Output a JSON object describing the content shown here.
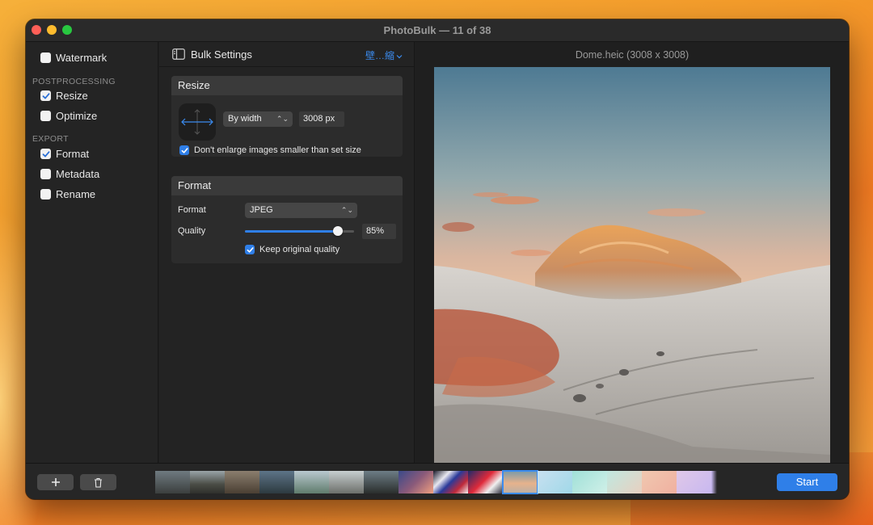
{
  "window": {
    "title": "PhotoBulk — 11 of 38"
  },
  "sidebar": {
    "items": [
      {
        "label": "Watermark",
        "checked": false
      }
    ],
    "sections": [
      {
        "title": "POSTPROCESSING",
        "items": [
          {
            "label": "Resize",
            "checked": true
          },
          {
            "label": "Optimize",
            "checked": false
          }
        ]
      },
      {
        "title": "EXPORT",
        "items": [
          {
            "label": "Format",
            "checked": true
          },
          {
            "label": "Metadata",
            "checked": false
          },
          {
            "label": "Rename",
            "checked": false
          }
        ]
      }
    ]
  },
  "settings": {
    "title": "Bulk Settings",
    "menu_label": "壁…縮",
    "resize": {
      "header": "Resize",
      "mode": "By width",
      "value": "3008 px",
      "no_enlarge_label": "Don't enlarge images smaller than set size",
      "no_enlarge_checked": true
    },
    "format": {
      "header": "Format",
      "format_label": "Format",
      "format_value": "JPEG",
      "quality_label": "Quality",
      "quality_value": "85%",
      "quality_fraction": 0.85,
      "keep_label": "Keep original quality",
      "keep_checked": true
    }
  },
  "preview": {
    "filename": "Dome.heic (3008 x 3008)"
  },
  "bottombar": {
    "start_label": "Start",
    "selected_thumbnail_index": 10
  },
  "colors": {
    "accent": "#2f7fe8",
    "window_bg": "#1f1f1f",
    "close": "#fe5f57",
    "minimize": "#febc2e",
    "maximize": "#28c840"
  }
}
